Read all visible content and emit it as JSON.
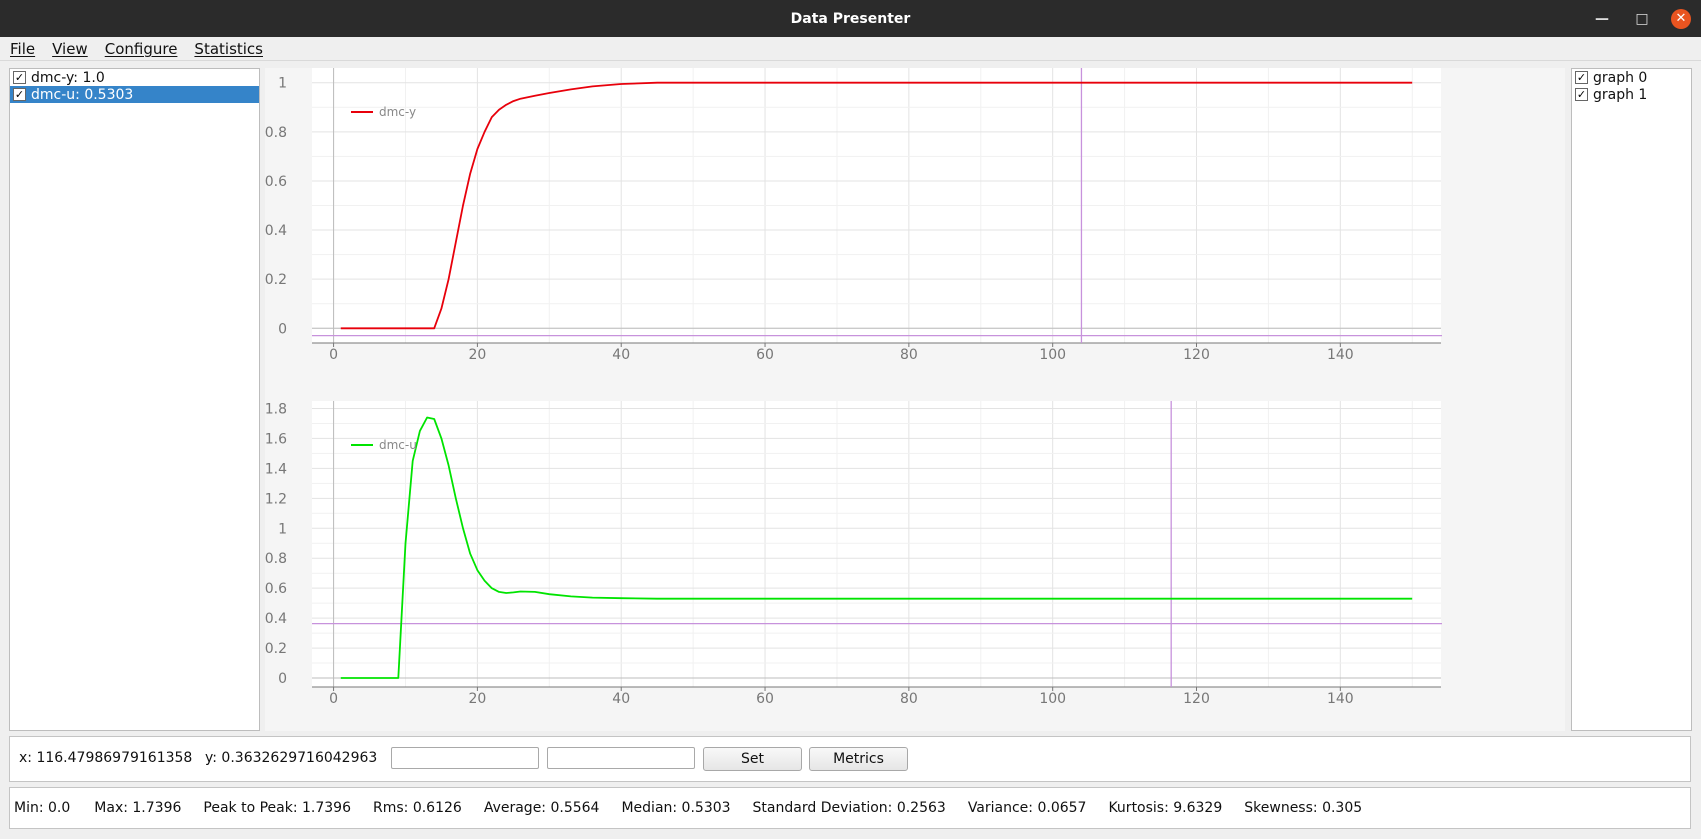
{
  "window": {
    "title": "Data Presenter"
  },
  "menu": [
    "File",
    "View",
    "Configure",
    "Statistics"
  ],
  "series_list": [
    {
      "label": "dmc-y: 1.0",
      "checked": true,
      "selected": false
    },
    {
      "label": "dmc-u: 0.5303",
      "checked": true,
      "selected": true
    }
  ],
  "graph_list": [
    {
      "label": "graph 0",
      "checked": true
    },
    {
      "label": "graph 1",
      "checked": true
    }
  ],
  "cursor": {
    "x_label": "x: 116.47986979161358",
    "y_label": "y: 0.3632629716042963"
  },
  "controls": {
    "set_label": "Set",
    "metrics_label": "Metrics",
    "input1_value": "",
    "input2_value": ""
  },
  "stats": {
    "min": "Min: 0.0",
    "max": "Max: 1.7396",
    "peak_to_peak": "Peak to Peak: 1.7396",
    "rms": "Rms: 0.6126",
    "average": "Average: 0.5564",
    "median": "Median: 0.5303",
    "std": "Standard Deviation: 0.2563",
    "variance": "Variance: 0.0657",
    "kurtosis": "Kurtosis: 9.6329",
    "skewness": "Skewness: 0.305"
  },
  "colors": {
    "dmc_y": "#e8000b",
    "dmc_u": "#00e400",
    "cursor": "#c792dc",
    "selection": "#3584c9"
  },
  "chart_data": [
    {
      "type": "line",
      "title": "",
      "xlabel": "",
      "ylabel": "",
      "xlim": [
        -3,
        154
      ],
      "ylim": [
        -0.06,
        1.06
      ],
      "xticks": [
        0,
        20,
        40,
        60,
        80,
        100,
        120,
        140
      ],
      "yticks": [
        0,
        0.2,
        0.4,
        0.6,
        0.8,
        1
      ],
      "legend": "top-left",
      "cursor": {
        "x": 104,
        "y": -0.03
      },
      "series": [
        {
          "name": "dmc-y",
          "color": "#e8000b",
          "x": [
            1,
            13,
            14,
            15,
            16,
            17,
            18,
            19,
            20,
            21,
            22,
            23,
            24,
            25,
            26,
            28,
            30,
            33,
            36,
            40,
            45,
            150
          ],
          "y": [
            0,
            0,
            0.0,
            0.08,
            0.2,
            0.35,
            0.5,
            0.63,
            0.73,
            0.8,
            0.86,
            0.89,
            0.91,
            0.925,
            0.935,
            0.947,
            0.958,
            0.973,
            0.985,
            0.995,
            1.0,
            1.0
          ]
        }
      ]
    },
    {
      "type": "line",
      "title": "",
      "xlabel": "",
      "ylabel": "",
      "xlim": [
        -3,
        154
      ],
      "ylim": [
        -0.06,
        1.85
      ],
      "xticks": [
        0,
        20,
        40,
        60,
        80,
        100,
        120,
        140
      ],
      "yticks": [
        0,
        0.2,
        0.4,
        0.6,
        0.8,
        1,
        1.2,
        1.4,
        1.6,
        1.8
      ],
      "legend": "top-left",
      "cursor": {
        "x": 116.48,
        "y": 0.3633
      },
      "series": [
        {
          "name": "dmc-u",
          "color": "#00e400",
          "x": [
            1,
            9,
            10,
            11,
            12,
            13,
            14,
            15,
            16,
            17,
            18,
            19,
            20,
            21,
            22,
            23,
            24,
            25,
            26,
            28,
            30,
            33,
            36,
            40,
            45,
            150
          ],
          "y": [
            0,
            0,
            0.9,
            1.45,
            1.65,
            1.74,
            1.73,
            1.6,
            1.42,
            1.2,
            1.0,
            0.83,
            0.72,
            0.65,
            0.6,
            0.575,
            0.568,
            0.572,
            0.578,
            0.575,
            0.56,
            0.545,
            0.537,
            0.533,
            0.53,
            0.53
          ]
        }
      ]
    }
  ]
}
